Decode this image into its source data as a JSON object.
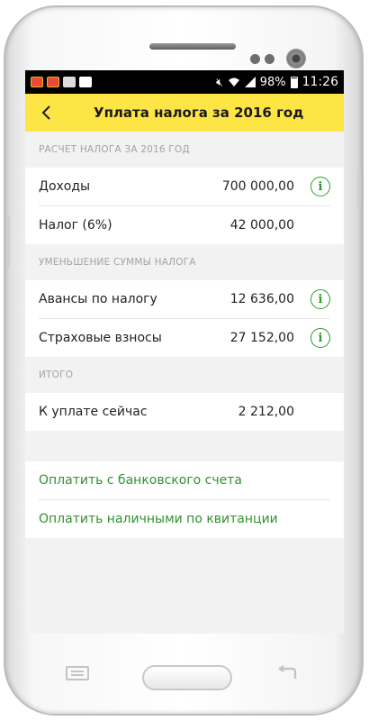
{
  "status_bar": {
    "battery_percent": "98%",
    "time": "11:26",
    "icons": [
      "app-badge-icon",
      "app-badge-icon",
      "gallery-icon",
      "flipboard-icon",
      "mute-icon",
      "wifi-icon",
      "signal-icon",
      "battery-icon"
    ]
  },
  "app_bar": {
    "title": "Уплата налога за 2016 год",
    "back_icon": "back-arrow-icon",
    "background": "#fde545"
  },
  "sections": {
    "calculation": {
      "header": "РАСЧЕТ НАЛОГА ЗА 2016 ГОД",
      "rows": [
        {
          "label": "Доходы",
          "value": "700 000,00",
          "info": true
        },
        {
          "label": "Налог (6%)",
          "value": "42 000,00",
          "info": false
        }
      ]
    },
    "reduction": {
      "header": "УМЕНЬШЕНИЕ СУММЫ НАЛОГА",
      "rows": [
        {
          "label": "Авансы по налогу",
          "value": "12 636,00",
          "info": true
        },
        {
          "label": "Страховые взносы",
          "value": "27 152,00",
          "info": true
        }
      ]
    },
    "total": {
      "header": "ИТОГО",
      "rows": [
        {
          "label": "К уплате сейчас",
          "value": "2 212,00",
          "info": false
        }
      ]
    }
  },
  "actions": {
    "pay_bank": "Оплатить с банковского счета",
    "pay_cash": "Оплатить наличными по квитанции"
  },
  "colors": {
    "accent_green": "#2e9a2e",
    "header_gray": "#a3a3a3",
    "background": "#f2f2f2"
  }
}
